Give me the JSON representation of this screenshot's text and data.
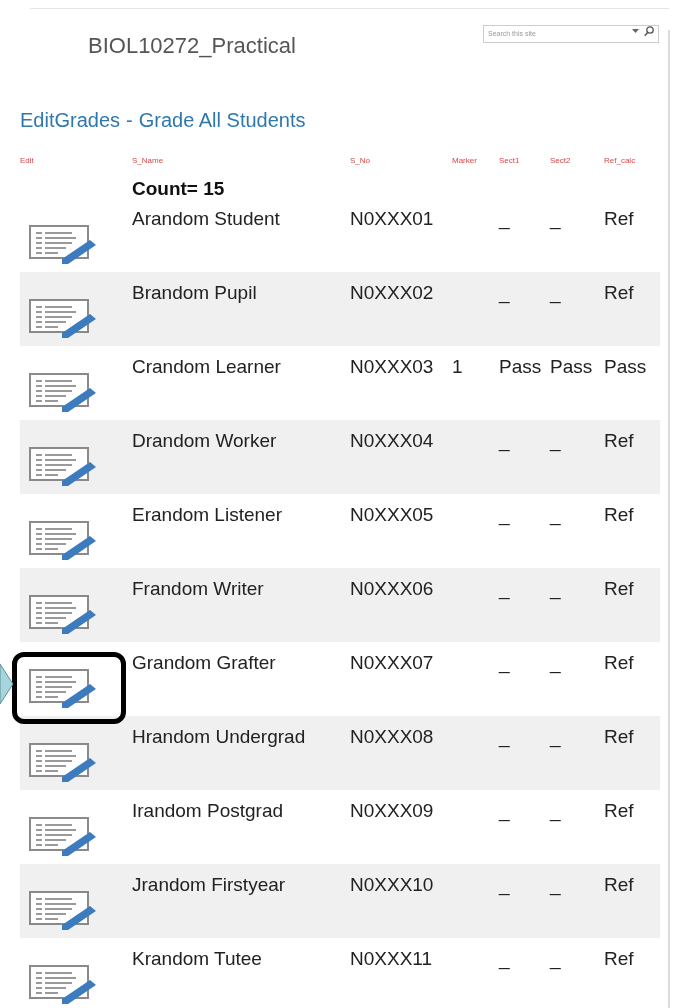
{
  "site_title": "BIOL10272_Practical",
  "search": {
    "placeholder": "Search this site"
  },
  "page_title": {
    "list": "EditGrades",
    "separator": "-",
    "view": "Grade All Students"
  },
  "table": {
    "columns": [
      "Edit",
      "S_Name",
      "S_No",
      "Marker",
      "Sect1",
      "Sect2",
      "Ref_calc"
    ],
    "count": "Count= 15",
    "rows": [
      {
        "name": "Arandom Student",
        "number": "N0XXX01",
        "sect1": "_",
        "sect2": "_",
        "ref_calc": "Ref",
        "highlighted": false
      },
      {
        "name": "Brandom Pupil",
        "number": "N0XXX02",
        "sect1": "_",
        "sect2": "_",
        "ref_calc": "Ref",
        "highlighted": false
      },
      {
        "name": "Crandom Learner",
        "number": "N0XXX03",
        "marker": "1",
        "sect1": "Pass",
        "sect2": "Pass",
        "ref_calc": "Pass",
        "highlighted": false
      },
      {
        "name": "Drandom Worker",
        "number": "N0XXX04",
        "sect1": "_",
        "sect2": "_",
        "ref_calc": "Ref",
        "highlighted": false
      },
      {
        "name": "Erandom Listener",
        "number": "N0XXX05",
        "sect1": "_",
        "sect2": "_",
        "ref_calc": "Ref",
        "highlighted": false
      },
      {
        "name": "Frandom Writer",
        "number": "N0XXX06",
        "sect1": "_",
        "sect2": "_",
        "ref_calc": "Ref",
        "highlighted": false
      },
      {
        "name": "Grandom Grafter",
        "number": "N0XXX07",
        "sect1": "_",
        "sect2": "_",
        "ref_calc": "Ref",
        "highlighted": true
      },
      {
        "name": "Hrandom Undergrad",
        "number": "N0XXX08",
        "sect1": "_",
        "sect2": "_",
        "ref_calc": "Ref",
        "highlighted": false
      },
      {
        "name": "Irandom Postgrad",
        "number": "N0XXX09",
        "sect1": "_",
        "sect2": "_",
        "ref_calc": "Ref",
        "highlighted": false
      },
      {
        "name": "Jrandom Firstyear",
        "number": "N0XXX10",
        "sect1": "_",
        "sect2": "_",
        "ref_calc": "Ref",
        "highlighted": false
      },
      {
        "name": "Krandom Tutee",
        "number": "N0XXX11",
        "sect1": "_",
        "sect2": "_",
        "ref_calc": "Ref",
        "highlighted": false
      }
    ]
  }
}
